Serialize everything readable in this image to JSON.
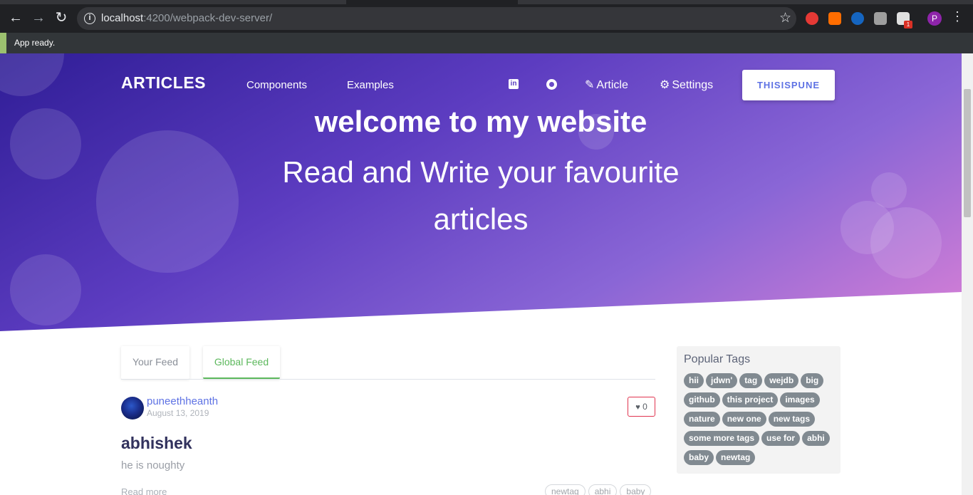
{
  "browser": {
    "url_host": "localhost",
    "url_rest": ":4200/webpack-dev-server/",
    "profile_initial": "P",
    "extension_badge": "1"
  },
  "toast": {
    "text": "App ready."
  },
  "nav": {
    "brand": "ARTICLES",
    "components": "Components",
    "examples": "Examples",
    "article": "Article",
    "settings": "Settings",
    "user": "THISISPUNE"
  },
  "hero": {
    "title": "welcome to my website",
    "subtitle": "Read and Write your favourite articles"
  },
  "feed": {
    "tabs": [
      {
        "label": "Your Feed",
        "active": false
      },
      {
        "label": "Global Feed",
        "active": true
      }
    ],
    "articles": [
      {
        "author": "puneethheanth",
        "date": "August 13, 2019",
        "favorites": "0",
        "title": "abhishek",
        "description": "he is noughty",
        "read_more": "Read more",
        "tags": [
          "newtag",
          "abhi",
          "baby"
        ]
      }
    ]
  },
  "sidebar": {
    "title": "Popular Tags",
    "tags": [
      "hii",
      "jdwn'",
      "tag",
      "wejdb",
      "big",
      "github",
      "this project",
      "images",
      "nature",
      "new one",
      "new tags",
      "some more tags",
      "use for",
      "abhi",
      "baby",
      "newtag"
    ]
  },
  "colors": {
    "hero_start": "#2f1d96",
    "hero_end": "#d880d6",
    "accent_green": "#5cb85c",
    "link_blue": "#5e72e4",
    "favorite_border": "#e0344f",
    "tag_gray": "#818a91"
  }
}
